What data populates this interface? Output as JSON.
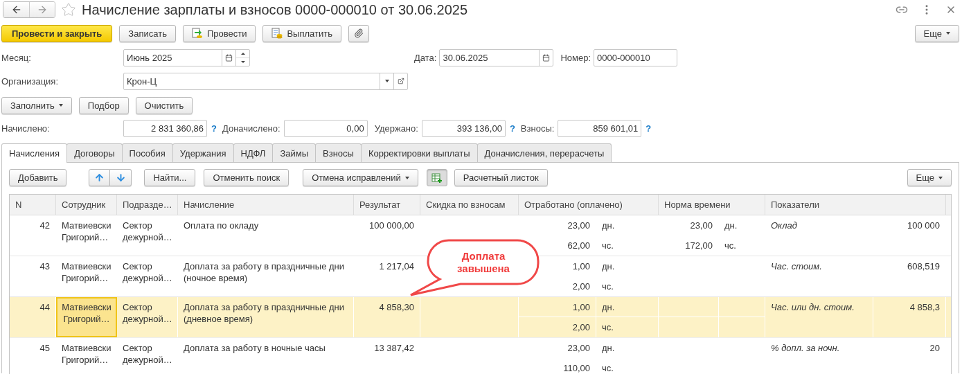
{
  "window": {
    "title": "Начисление зарплаты и взносов 0000-000010 от 30.06.2025",
    "starred": false
  },
  "command_bar": {
    "buttons": [
      {
        "kind": "primary",
        "label": "Провести и закрыть"
      },
      {
        "kind": "plain",
        "label": "Записать"
      },
      {
        "kind": "post",
        "label": "Провести"
      },
      {
        "kind": "pay",
        "label": "Выплатить"
      },
      {
        "kind": "attach"
      }
    ],
    "more": "Еще"
  },
  "fields": {
    "month": {
      "label": "Месяц:",
      "value": "Июнь 2025"
    },
    "date": {
      "label": "Дата:",
      "value": "30.06.2025"
    },
    "number": {
      "label": "Номер:",
      "value": "0000-000010"
    },
    "organization": {
      "label": "Организация:",
      "value": "Крон-Ц"
    }
  },
  "fill_buttons": [
    {
      "label": "Заполнить",
      "dropdown": true
    },
    {
      "label": "Подбор",
      "dropdown": false
    },
    {
      "label": "Очистить",
      "dropdown": false
    }
  ],
  "totals": [
    {
      "label": "Начислено:",
      "value": "2 831 360,86",
      "help": "?"
    },
    {
      "label": "Доначислено:",
      "value": "0,00"
    },
    {
      "label": "Удержано:",
      "value": "393 136,00",
      "help": "?"
    },
    {
      "label": "Взносы:",
      "value": "859 601,01",
      "help": "?"
    }
  ],
  "tabs": [
    {
      "label": "Начисления",
      "selected": true
    },
    {
      "label": "Договоры",
      "selected": false
    },
    {
      "label": "Пособия",
      "selected": false
    },
    {
      "label": "Удержания",
      "selected": false
    },
    {
      "label": "НДФЛ",
      "selected": false
    },
    {
      "label": "Займы",
      "selected": false
    },
    {
      "label": "Взносы",
      "selected": false
    },
    {
      "label": "Корректировки выплаты",
      "selected": false
    },
    {
      "label": "Доначисления, перерасчеты",
      "selected": false
    }
  ],
  "table_toolbar": {
    "items": [
      {
        "kind": "button",
        "label": "Добавить"
      },
      {
        "kind": "move_up"
      },
      {
        "kind": "move_down"
      },
      {
        "kind": "button",
        "label": "Найти..."
      },
      {
        "kind": "button",
        "label": "Отменить поиск"
      },
      {
        "kind": "dropdown",
        "label": "Отмена исправлений"
      },
      {
        "kind": "toggle",
        "pressed": true
      },
      {
        "kind": "button",
        "label": "Расчетный листок"
      }
    ],
    "more": "Еще"
  },
  "table": {
    "columns": [
      "N",
      "Сотрудник",
      "Подразде…",
      "Начисление",
      "Результат",
      "Скидка по взносам",
      "Отработано (оплачено)",
      "Норма времени",
      "Показатели"
    ],
    "rows": [
      {
        "n": "42",
        "employee": "Матвиевски Григорий…",
        "department": "Сектор дежурной…",
        "accrual": "Оплата по окладу",
        "result": "100 000,00",
        "worked": [
          {
            "value": "23,00",
            "unit": "дн."
          },
          {
            "value": "62,00",
            "unit": "чс."
          }
        ],
        "norm": [
          {
            "value": "23,00",
            "unit": "дн."
          },
          {
            "value": "172,00",
            "unit": "чс."
          }
        ],
        "indicator": "Оклад",
        "indicator_value": "100 000",
        "selected": false
      },
      {
        "n": "43",
        "employee": "Матвиевски Григорий…",
        "department": "Сектор дежурной…",
        "accrual": "Доплата за работу в праздничные дни (ночное время)",
        "result": "1 217,04",
        "worked": [
          {
            "value": "1,00",
            "unit": "дн."
          },
          {
            "value": "2,00",
            "unit": "чс."
          }
        ],
        "indicator": "Час. стоим.",
        "indicator_value": "608,519",
        "selected": false
      },
      {
        "n": "44",
        "employee": "Матвиевски Григорий…",
        "department": "Сектор дежурной…",
        "accrual": "Доплата за работу в праздничные дни (дневное время)",
        "result": "4 858,30",
        "worked": [
          {
            "value": "1,00",
            "unit": "дн."
          },
          {
            "value": "2,00",
            "unit": "чс."
          }
        ],
        "indicator": "Час. или дн. стоим.",
        "indicator_value": "4 858,3",
        "selected": true
      },
      {
        "n": "45",
        "employee": "Матвиевски Григорий…",
        "department": "Сектор дежурной…",
        "accrual": "Доплата за работу в ночные часы",
        "result": "13 387,42",
        "worked": [
          {
            "value": "23,00",
            "unit": "дн."
          },
          {
            "value": "110,00",
            "unit": "чс."
          }
        ],
        "indicator": "% допл. за ночн.",
        "indicator_value": "20",
        "selected": false
      }
    ]
  },
  "callout": {
    "text": "Доплата завышена"
  }
}
